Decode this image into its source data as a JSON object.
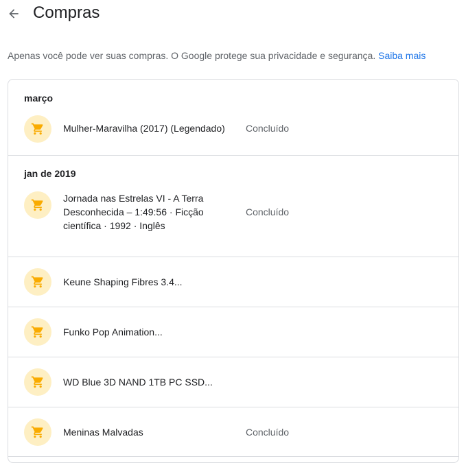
{
  "header": {
    "title": "Compras",
    "back_icon": "arrow-back-icon"
  },
  "privacy": {
    "text": "Apenas você pode ver suas compras. O Google protege sua privacidade e segurança.",
    "link": "Saiba mais"
  },
  "colors": {
    "icon_bg": "#feefc3",
    "icon_fg": "#f9ab00",
    "link": "#1a73e8",
    "divider": "#dadce0"
  },
  "groups": [
    {
      "month": "março",
      "items": [
        {
          "title": "Mulher-Maravilha (2017) (Legendado)",
          "status": "Concluído",
          "icon": "shopping-cart-icon"
        }
      ]
    },
    {
      "month": "jan de 2019",
      "items": [
        {
          "title_lines": [
            "Jornada nas Estrelas VI - A Terra",
            "Desconhecida – 1:49:56 · Ficção",
            "científica · 1992 · Inglês"
          ],
          "status": "Concluído",
          "icon": "shopping-cart-icon"
        },
        {
          "title": "Keune Shaping Fibres 3.4...",
          "status": "",
          "icon": "shopping-cart-icon"
        },
        {
          "title": "Funko Pop Animation...",
          "status": "",
          "icon": "shopping-cart-icon"
        },
        {
          "title": "WD Blue 3D NAND 1TB PC SSD...",
          "status": "",
          "icon": "shopping-cart-icon"
        },
        {
          "title": "Meninas Malvadas",
          "status": "Concluído",
          "icon": "shopping-cart-icon"
        }
      ]
    }
  ]
}
